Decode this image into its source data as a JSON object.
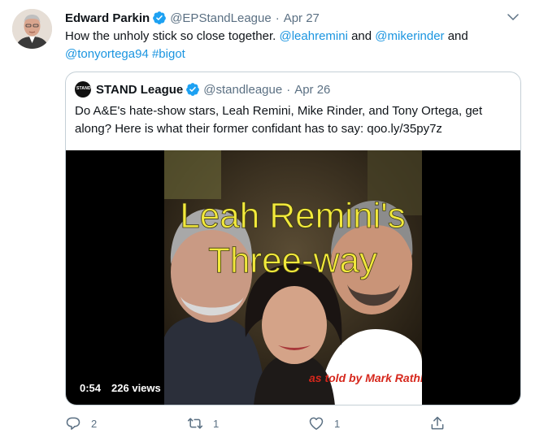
{
  "tweet": {
    "author": "Edward Parkin",
    "handle": "@EPStandLeague",
    "date": "Apr 27",
    "text_plain": "How the unholy stick so close together.",
    "mentions": [
      "@leahremini",
      "@mikerinder",
      "@tonyortega94"
    ],
    "joiner": "and",
    "hashtag": "#bigot"
  },
  "quoted": {
    "author": "STAND League",
    "handle": "@standleague",
    "date": "Apr 26",
    "avatar_text": "STAND",
    "text": "Do A&E's hate-show stars, Leah Remini, Mike Rinder, and Tony Ortega, get along? Here is what their former confidant has to say: qoo.ly/35py7z",
    "video": {
      "title_line1": "Leah Remini's",
      "title_line2": "Three-way",
      "caption": "as told by Mark Rathbun",
      "duration": "0:54",
      "views": "226 views"
    }
  },
  "actions": {
    "reply_count": "2",
    "retweet_count": "1",
    "like_count": "1"
  },
  "colors": {
    "accent": "#1b95e0",
    "muted": "#5b7083",
    "verified": "#1da1f2",
    "video_title": "#f2e93c",
    "video_caption": "#d6271c"
  }
}
